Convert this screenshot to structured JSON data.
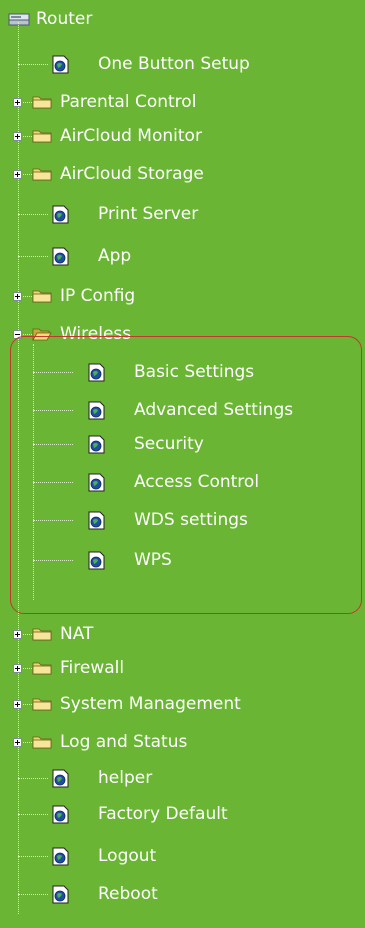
{
  "nav_tree": {
    "root": {
      "label": "Router",
      "icon": "router-icon"
    },
    "items": [
      {
        "label": "One Button Setup",
        "type": "page",
        "icon": "page-icon"
      },
      {
        "label": "Parental Control",
        "type": "folder",
        "expanded": false,
        "icon": "folder-icon"
      },
      {
        "label": "AirCloud Monitor",
        "type": "folder",
        "expanded": false,
        "icon": "folder-icon"
      },
      {
        "label": "AirCloud Storage",
        "type": "folder",
        "expanded": false,
        "icon": "folder-icon"
      },
      {
        "label": "Print Server",
        "type": "page",
        "icon": "page-icon"
      },
      {
        "label": "App",
        "type": "page",
        "icon": "page-icon"
      },
      {
        "label": "IP Config",
        "type": "folder",
        "expanded": false,
        "icon": "folder-icon"
      },
      {
        "label": "Wireless",
        "type": "folder",
        "expanded": true,
        "icon": "folder-open-icon",
        "highlighted": true,
        "children": [
          {
            "label": "Basic Settings",
            "icon": "page-icon"
          },
          {
            "label": "Advanced Settings",
            "icon": "page-icon"
          },
          {
            "label": "Security",
            "icon": "page-icon"
          },
          {
            "label": "Access Control",
            "icon": "page-icon"
          },
          {
            "label": "WDS settings",
            "icon": "page-icon"
          },
          {
            "label": "WPS",
            "icon": "page-icon"
          }
        ]
      },
      {
        "label": "NAT",
        "type": "folder",
        "expanded": false,
        "icon": "folder-icon"
      },
      {
        "label": "Firewall",
        "type": "folder",
        "expanded": false,
        "icon": "folder-icon"
      },
      {
        "label": "System Management",
        "type": "folder",
        "expanded": false,
        "icon": "folder-icon"
      },
      {
        "label": "Log and Status",
        "type": "folder",
        "expanded": false,
        "icon": "folder-icon"
      },
      {
        "label": "helper",
        "type": "page",
        "icon": "page-icon"
      },
      {
        "label": "Factory Default",
        "type": "page",
        "icon": "page-icon"
      },
      {
        "label": "Logout",
        "type": "page",
        "icon": "page-icon"
      },
      {
        "label": "Reboot",
        "type": "page",
        "icon": "page-icon"
      }
    ]
  },
  "colors": {
    "background": "#6ab534",
    "text": "#ffffff",
    "highlight_border": "#c0392b",
    "folder": "#f2d66b",
    "page_globe": "#1f4fa0"
  }
}
